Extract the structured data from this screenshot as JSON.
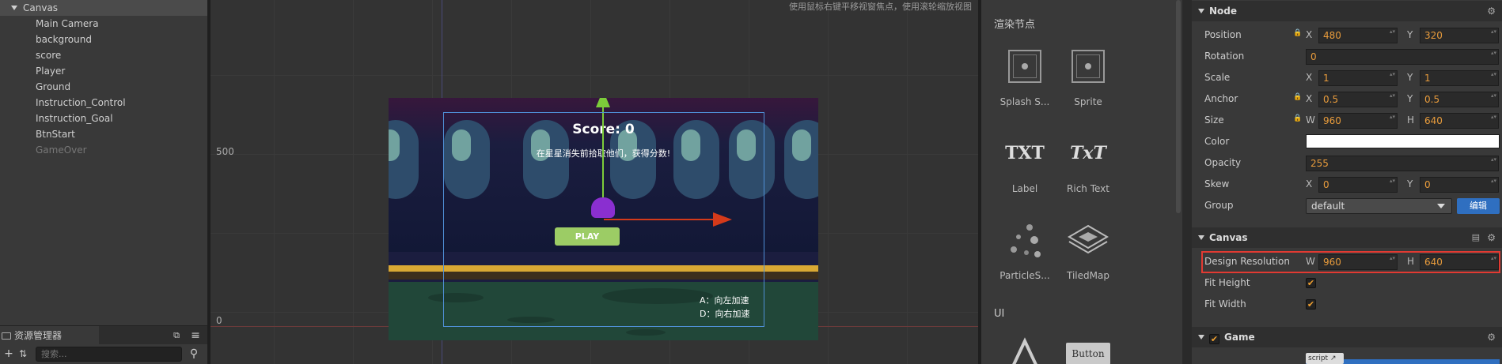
{
  "hierarchy": {
    "root": "Canvas",
    "children": [
      "Main Camera",
      "background",
      "score",
      "Player",
      "Ground",
      "Instruction_Control",
      "Instruction_Goal",
      "BtnStart",
      "GameOver"
    ]
  },
  "assets": {
    "title": "资源管理器",
    "search_placeholder": "搜索..."
  },
  "scene": {
    "hint": "使用鼠标右键平移视窗焦点，使用滚轮缩放视图",
    "axis_label_500": "500",
    "axis_label_0": "0",
    "game": {
      "score_text": "Score: 0",
      "goal_text": "在星星消失前拾取他们，获得分数!",
      "play_label": "PLAY",
      "control_line1": "A：向左加速",
      "control_line2": "D：向右加速"
    }
  },
  "library": {
    "section_render": "渲染节点",
    "section_ui": "UI",
    "items": [
      {
        "label": "Splash S...",
        "icon": "splash-sprite-icon"
      },
      {
        "label": "Sprite",
        "icon": "sprite-icon"
      },
      {
        "label": "Label",
        "icon": "label-icon",
        "glyph": "TXT"
      },
      {
        "label": "Rich Text",
        "icon": "rich-text-icon",
        "glyph": "TxT"
      },
      {
        "label": "ParticleS...",
        "icon": "particle-system-icon"
      },
      {
        "label": "TiledMap",
        "icon": "tiledmap-icon"
      }
    ],
    "ui_items": [
      {
        "label": "Button",
        "icon": "button-icon"
      }
    ]
  },
  "properties": {
    "node": {
      "title": "Node",
      "position": {
        "label": "Position",
        "x": "480",
        "y": "320"
      },
      "rotation": {
        "label": "Rotation",
        "value": "0"
      },
      "scale": {
        "label": "Scale",
        "x": "1",
        "y": "1"
      },
      "anchor": {
        "label": "Anchor",
        "x": "0.5",
        "y": "0.5"
      },
      "size": {
        "label": "Size",
        "w": "960",
        "h": "640"
      },
      "color": {
        "label": "Color",
        "value": "#ffffff"
      },
      "opacity": {
        "label": "Opacity",
        "value": "255"
      },
      "skew": {
        "label": "Skew",
        "x": "0",
        "y": "0"
      },
      "group": {
        "label": "Group",
        "value": "default",
        "edit_label": "编辑"
      }
    },
    "canvas": {
      "title": "Canvas",
      "design_resolution": {
        "label": "Design Resolution",
        "w": "960",
        "h": "640"
      },
      "fit_height": {
        "label": "Fit Height",
        "checked": true
      },
      "fit_width": {
        "label": "Fit Width",
        "checked": true
      }
    },
    "game": {
      "title": "Game",
      "script_tag": "script"
    },
    "axis": {
      "x": "X",
      "y": "Y",
      "w": "W",
      "h": "H"
    },
    "check_glyph": "✔"
  },
  "colors": {
    "accent_blue": "#2f6fc0",
    "value_orange": "#e99c3c",
    "highlight_red": "#e23a32",
    "play_green": "#9ccc65"
  }
}
